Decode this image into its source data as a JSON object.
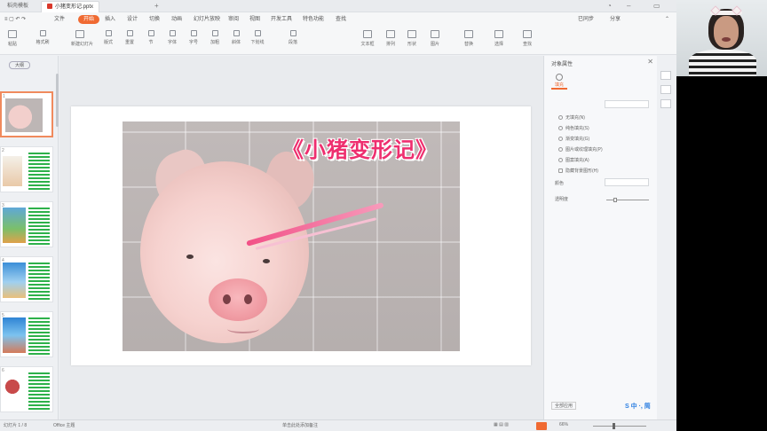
{
  "titlebar": {
    "tabs": [
      {
        "label": "稻壳模板"
      },
      {
        "label": "小猪变形记.pptx"
      }
    ],
    "add_tab": "+"
  },
  "menu": {
    "items": [
      "文件",
      "开始",
      "插入",
      "设计",
      "切换",
      "动画",
      "幻灯片放映",
      "审阅",
      "视图",
      "开发工具",
      "特色功能",
      "查找"
    ],
    "active_index": 1,
    "sync_label": "已同步",
    "share_label": "分享"
  },
  "ribbon": {
    "buttons": [
      "粘贴",
      "格式刷",
      "新建幻灯片",
      "版式",
      "重置",
      "节",
      "字体",
      "字号",
      "加粗",
      "斜体",
      "下划线",
      "段落",
      "文本框",
      "排列",
      "形状",
      "图片",
      "替换",
      "选择",
      "查找"
    ]
  },
  "thumbs": {
    "pane_tag": "大纲",
    "slides": [
      "1",
      "2",
      "3",
      "4",
      "5",
      "6"
    ]
  },
  "slide": {
    "title": "《小猪变形记》"
  },
  "panel": {
    "header": "对象属性",
    "tab_label": "填充",
    "options": [
      "无填充(N)",
      "纯色填充(S)",
      "渐变填充(G)",
      "图片或纹理填充(P)",
      "图案填充(A)",
      "隐藏背景图形(H)"
    ],
    "fields": [
      "颜色",
      "透明度"
    ],
    "bottom": "全部应用"
  },
  "statusbar": {
    "left": "幻灯片 1 / 8",
    "theme": "Office 主题",
    "notes": "单击此处添加备注",
    "zoom": "66%"
  },
  "brand": {
    "accent": "#f06a32",
    "logo": "S",
    "logo_text": "中 ·, 简"
  }
}
